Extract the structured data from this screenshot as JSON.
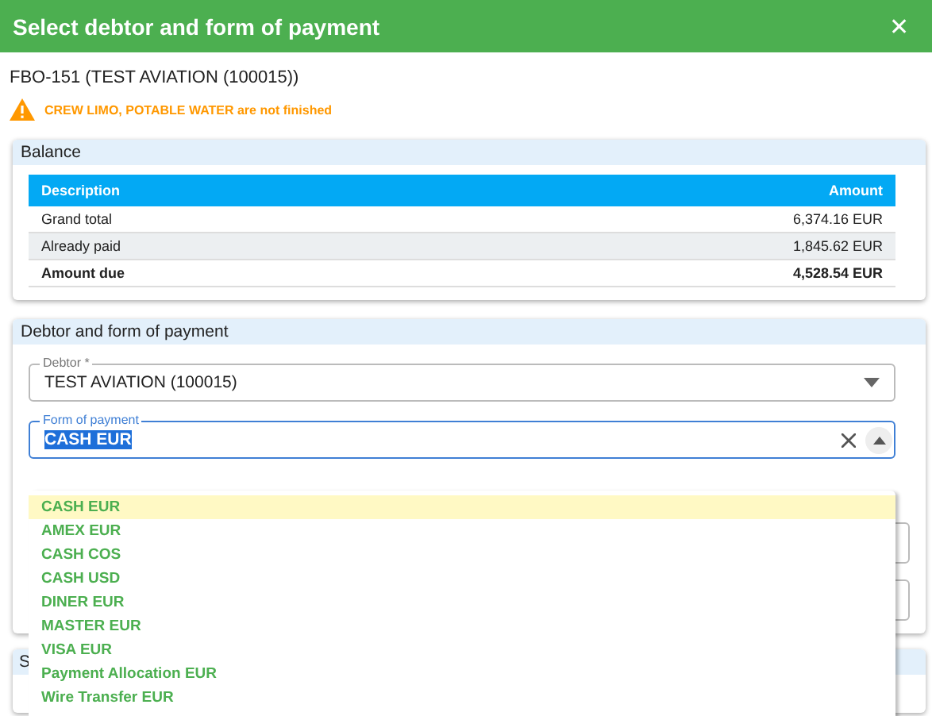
{
  "window": {
    "title": "Select debtor and form of payment",
    "close": "✕"
  },
  "subtitle": "FBO-151 (TEST AVIATION (100015))",
  "warning": "CREW LIMO, POTABLE WATER are not finished",
  "balance": {
    "title": "Balance",
    "columns": [
      "Description",
      "Amount"
    ],
    "rows": [
      {
        "description": "Grand total",
        "amount": "6,374.16 EUR",
        "bold": false
      },
      {
        "description": "Already paid",
        "amount": "1,845.62 EUR",
        "bold": false
      },
      {
        "description": "Amount due",
        "amount": "4,528.54 EUR",
        "bold": true
      }
    ]
  },
  "debtor_section": {
    "title": "Debtor and form of payment",
    "debtor": {
      "label": "Debtor *",
      "value": "TEST AVIATION (100015)"
    },
    "payment": {
      "label": "Form of payment",
      "value": "CASH EUR",
      "expanded": true
    },
    "options": [
      {
        "label": "CASH EUR",
        "selected": true
      },
      {
        "label": "AMEX EUR",
        "selected": false
      },
      {
        "label": "CASH COS",
        "selected": false
      },
      {
        "label": "CASH USD",
        "selected": false
      },
      {
        "label": "DINER EUR",
        "selected": false
      },
      {
        "label": "MASTER EUR",
        "selected": false
      },
      {
        "label": "VISA EUR",
        "selected": false
      },
      {
        "label": "Payment Allocation EUR",
        "selected": false
      },
      {
        "label": "Wire Transfer EUR",
        "selected": false
      }
    ]
  },
  "next_section": {
    "title": "S"
  }
}
